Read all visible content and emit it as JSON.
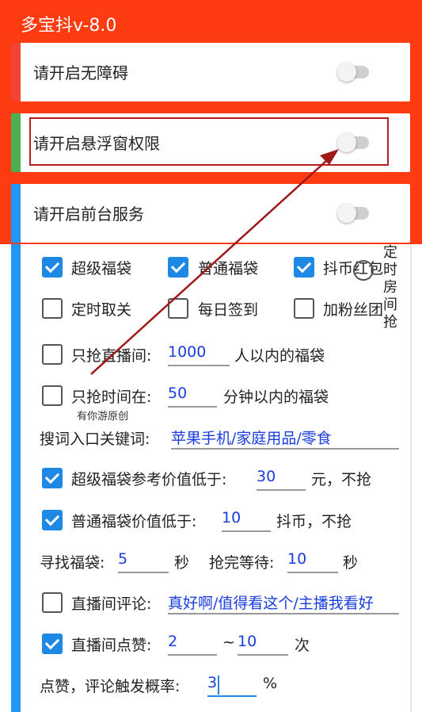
{
  "app": {
    "title": "多宝抖v-8.0",
    "accent": "#ff3b12"
  },
  "permissions": [
    {
      "label": "请开启无障碍",
      "color": "#f44336",
      "enabled": false
    },
    {
      "label": "请开启悬浮窗权限",
      "color": "#4caf50",
      "enabled": false
    },
    {
      "label": "请开启前台服务",
      "color": "#2196f3",
      "enabled": false
    }
  ],
  "options": {
    "row1": [
      {
        "label": "超级福袋",
        "checked": true
      },
      {
        "label": "普通福袋",
        "checked": true
      },
      {
        "label": "抖币红包",
        "checked": true
      }
    ],
    "row2": [
      {
        "label": "定时取关",
        "checked": false
      },
      {
        "label": "每日签到",
        "checked": false
      },
      {
        "label": "加粉丝团",
        "checked": false
      }
    ],
    "side_text": "定时房间抢"
  },
  "live_room": {
    "prefix": "只抢直播间:",
    "value": "1000",
    "suffix": "人以内的福袋",
    "checked": false
  },
  "time_limit": {
    "prefix": "只抢时间在:",
    "value": "50",
    "suffix": "分钟以内的福袋",
    "checked": false
  },
  "watermark": "有你游原创",
  "keywords": {
    "label": "搜词入口关键词:",
    "value": "苹果手机/家庭用品/零食"
  },
  "super_bag": {
    "prefix": "超级福袋参考价值低于:",
    "value": "30",
    "suffix": "元，不抢",
    "checked": true
  },
  "normal_bag": {
    "prefix": "普通福袋价值低于:",
    "value": "10",
    "suffix": "抖币，不抢",
    "checked": true
  },
  "timing": {
    "find_label": "寻找福袋:",
    "find_value": "5",
    "find_unit": "秒",
    "wait_label": "抢完等待:",
    "wait_value": "10",
    "wait_unit": "秒"
  },
  "comment": {
    "label": "直播间评论:",
    "value": "真好啊/值得看这个/主播我看好",
    "checked": false
  },
  "like": {
    "label": "直播间点赞:",
    "min": "2",
    "tilde": "~",
    "max": "10",
    "unit": "次",
    "checked": true
  },
  "probability": {
    "label": "点赞，评论触发概率:",
    "value": "3",
    "unit": "%"
  }
}
